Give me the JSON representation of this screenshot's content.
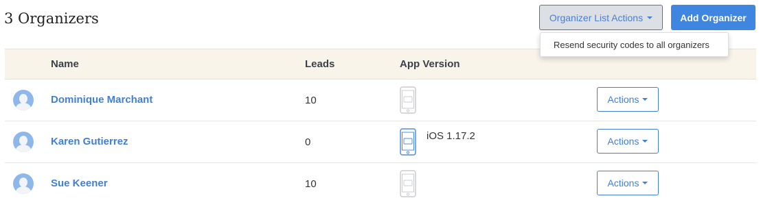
{
  "header": {
    "title": "3 Organizers",
    "list_actions_label": "Organizer List Actions",
    "add_label": "Add Organizer"
  },
  "dropdown": {
    "items": [
      {
        "label": "Resend security codes to all organizers"
      }
    ]
  },
  "table": {
    "columns": [
      "Name",
      "Leads",
      "App Version"
    ],
    "rows": [
      {
        "name": "Dominique Marchant",
        "leads": "10",
        "app_version": "",
        "device_active": false,
        "actions_label": "Actions"
      },
      {
        "name": "Karen Gutierrez",
        "leads": "0",
        "app_version": "iOS 1.17.2",
        "device_active": true,
        "actions_label": "Actions"
      },
      {
        "name": "Sue Keener",
        "leads": "10",
        "app_version": "",
        "device_active": false,
        "actions_label": "Actions"
      }
    ]
  },
  "colors": {
    "accent": "#3f7fd6",
    "header_bg": "#f8f4e9",
    "device_active": "#4f8ee0",
    "device_inactive": "#c9ccd1"
  }
}
